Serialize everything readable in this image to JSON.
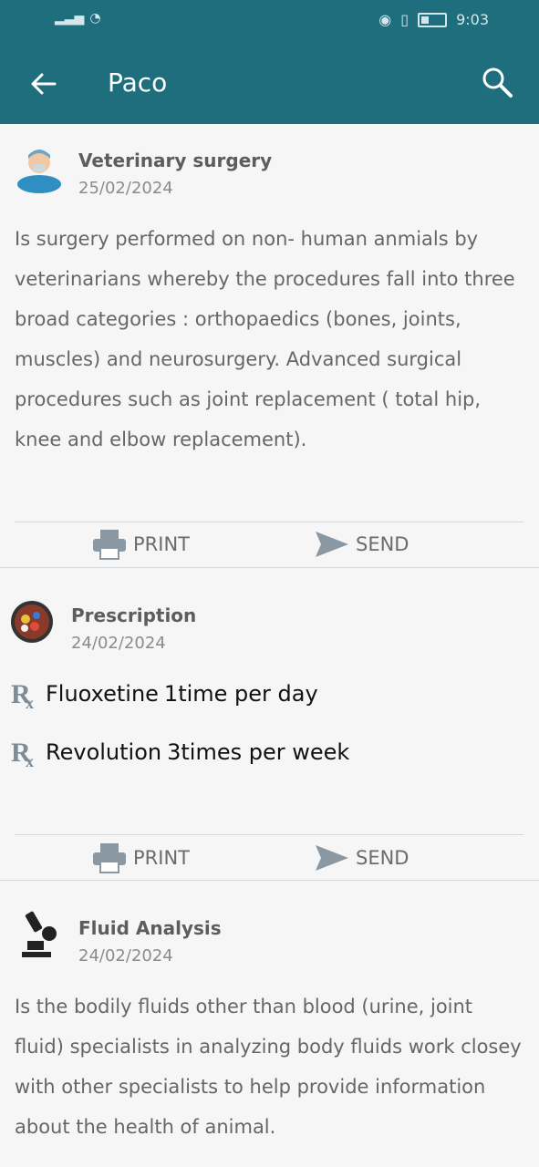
{
  "status": {
    "time": "9:03"
  },
  "header": {
    "title": "Paco"
  },
  "records": [
    {
      "title": "Veterinary surgery",
      "date": "25/02/2024",
      "text": "Is surgery performed on non- human anmials by veterinarians whereby the procedures fall into three broad categories : orthopaedics (bones, joints, muscles) and neurosurgery. Advanced surgical procedures such as joint replacement ( total hip, knee and elbow replacement).",
      "print": "PRINT",
      "send": "SEND"
    },
    {
      "title": "Prescription",
      "date": "24/02/2024",
      "items": [
        {
          "name": "Fluoxetine",
          "dose": "1time per day"
        },
        {
          "name": "Revolution",
          "dose": "3times per week"
        }
      ],
      "print": "PRINT",
      "send": "SEND"
    },
    {
      "title": "Fluid Analysis",
      "date": "24/02/2024",
      "text": "Is the bodily fluids other than blood (urine, joint fluid) specialists in analyzing body fluids work closey with other specialists to help provide information about the health of animal."
    }
  ],
  "colors": {
    "appbar": "#1f6e7d",
    "icon": "#8a98a4"
  }
}
